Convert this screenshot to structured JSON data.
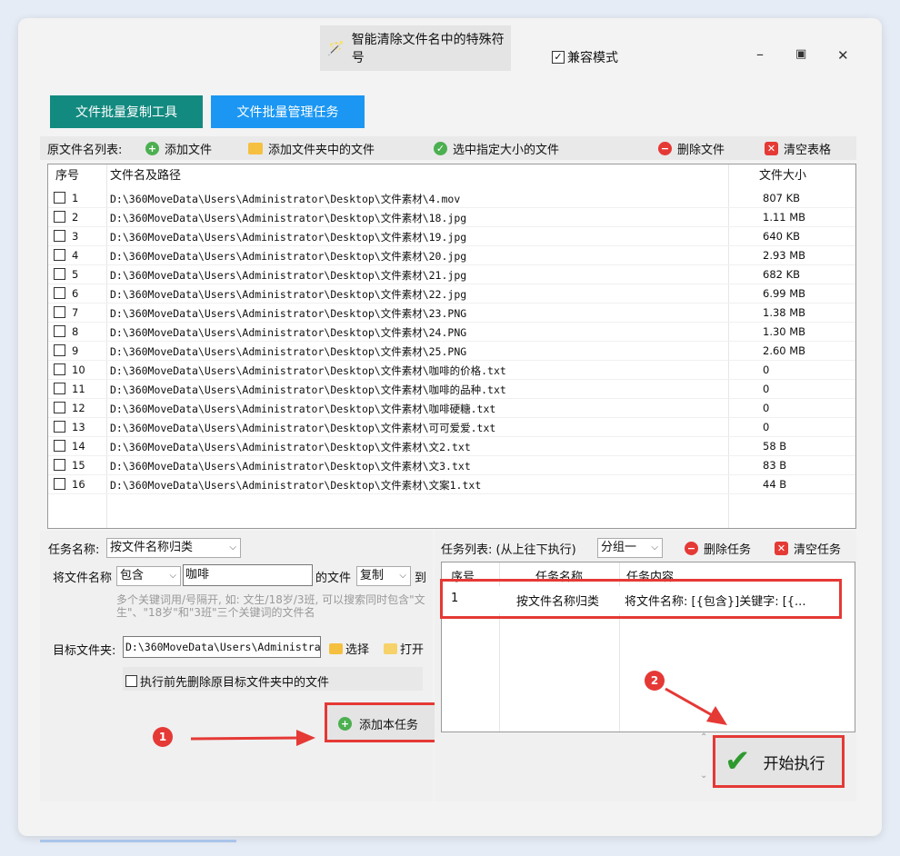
{
  "window": {
    "title": "智能清除文件名中的特殊符号",
    "compat_label": "兼容模式",
    "compat_checked": true
  },
  "tabs": [
    "文件批量复制工具",
    "文件批量管理任务"
  ],
  "toolbar": {
    "list_label": "原文件名列表:",
    "add_file": "添加文件",
    "add_folder": "添加文件夹中的文件",
    "select_size": "选中指定大小的文件",
    "delete_file": "删除文件",
    "clear_table": "清空表格"
  },
  "grid": {
    "headers": [
      "序号",
      "文件名及路径",
      "文件大小"
    ],
    "rows": [
      [
        "1",
        "D:\\360MoveData\\Users\\Administrator\\Desktop\\文件素材\\4.mov",
        "807 KB"
      ],
      [
        "2",
        "D:\\360MoveData\\Users\\Administrator\\Desktop\\文件素材\\18.jpg",
        "1.11 MB"
      ],
      [
        "3",
        "D:\\360MoveData\\Users\\Administrator\\Desktop\\文件素材\\19.jpg",
        "640 KB"
      ],
      [
        "4",
        "D:\\360MoveData\\Users\\Administrator\\Desktop\\文件素材\\20.jpg",
        "2.93 MB"
      ],
      [
        "5",
        "D:\\360MoveData\\Users\\Administrator\\Desktop\\文件素材\\21.jpg",
        "682 KB"
      ],
      [
        "6",
        "D:\\360MoveData\\Users\\Administrator\\Desktop\\文件素材\\22.jpg",
        "6.99 MB"
      ],
      [
        "7",
        "D:\\360MoveData\\Users\\Administrator\\Desktop\\文件素材\\23.PNG",
        "1.38 MB"
      ],
      [
        "8",
        "D:\\360MoveData\\Users\\Administrator\\Desktop\\文件素材\\24.PNG",
        "1.30 MB"
      ],
      [
        "9",
        "D:\\360MoveData\\Users\\Administrator\\Desktop\\文件素材\\25.PNG",
        "2.60 MB"
      ],
      [
        "10",
        "D:\\360MoveData\\Users\\Administrator\\Desktop\\文件素材\\咖啡的价格.txt",
        "0"
      ],
      [
        "11",
        "D:\\360MoveData\\Users\\Administrator\\Desktop\\文件素材\\咖啡的品种.txt",
        "0"
      ],
      [
        "12",
        "D:\\360MoveData\\Users\\Administrator\\Desktop\\文件素材\\咖啡硬糖.txt",
        "0"
      ],
      [
        "13",
        "D:\\360MoveData\\Users\\Administrator\\Desktop\\文件素材\\可可爱爱.txt",
        "0"
      ],
      [
        "14",
        "D:\\360MoveData\\Users\\Administrator\\Desktop\\文件素材\\文2.txt",
        "58 B"
      ],
      [
        "15",
        "D:\\360MoveData\\Users\\Administrator\\Desktop\\文件素材\\文3.txt",
        "83 B"
      ],
      [
        "16",
        "D:\\360MoveData\\Users\\Administrator\\Desktop\\文件素材\\文案1.txt",
        "44 B"
      ]
    ]
  },
  "task_form": {
    "name_label": "任务名称:",
    "name_value": "按文件名称归类",
    "rule_prefix": "将文件名称",
    "rule_op": "包含",
    "keyword": "咖啡",
    "rule_mid": "的文件",
    "action": "复制",
    "rule_to": "到",
    "hint": "多个关键词用/号隔开, 如: 文生/18岁/3班, 可以搜索同时包含\"文生\"、\"18岁\"和\"3班\"三个关键词的文件名",
    "target_label": "目标文件夹:",
    "target_value": "D:\\360MoveData\\Users\\Administrat",
    "choose": "选择",
    "open": "打开",
    "pre_delete": "执行前先删除原目标文件夹中的文件",
    "add_task": "添加本任务"
  },
  "task_list": {
    "label": "任务列表: (从上往下执行)",
    "group": "分组一",
    "delete_task": "删除任务",
    "clear_tasks": "清空任务",
    "headers": [
      "序号",
      "任务名称",
      "任务内容"
    ],
    "rows": [
      [
        "1",
        "按文件名称归类",
        "将文件名称: [{包含}]关键字: [{..."
      ]
    ]
  },
  "start": "开始执行",
  "badges": [
    "1",
    "2"
  ]
}
